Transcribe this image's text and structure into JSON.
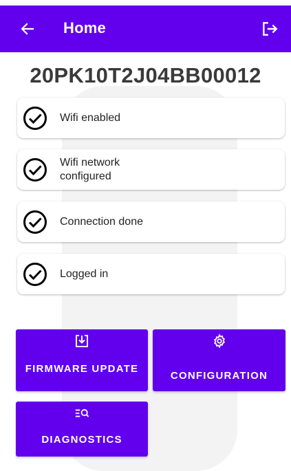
{
  "appbar": {
    "title": "Home",
    "back_icon": "arrow-left-icon",
    "logout_icon": "logout-icon"
  },
  "device": {
    "serial": "20PK10T2J04BB00012"
  },
  "status_items": [
    {
      "label": "Wifi enabled",
      "icon": "check-circle-icon",
      "done": true
    },
    {
      "label": "Wifi network configured",
      "icon": "check-circle-icon",
      "done": true
    },
    {
      "label": "Connection done",
      "icon": "check-circle-icon",
      "done": true
    },
    {
      "label": "Logged in",
      "icon": "check-circle-icon",
      "done": true
    }
  ],
  "actions": {
    "firmware_update": {
      "label": "FIRMWARE UPDATE",
      "icon": "download-box-icon"
    },
    "configuration": {
      "label": "CONFIGURATION",
      "icon": "gear-icon"
    },
    "diagnostics": {
      "label": "DIAGNOSTICS",
      "icon": "list-search-icon"
    }
  },
  "colors": {
    "primary": "#6200ee",
    "on_primary": "#ffffff",
    "serial_text": "#3a3a3a"
  }
}
